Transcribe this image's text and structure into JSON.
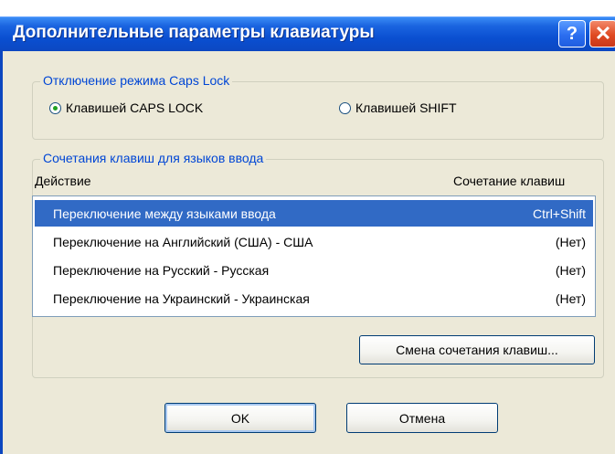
{
  "window": {
    "title": "Дополнительные параметры клавиатуры",
    "help_glyph": "?",
    "close_glyph": "✕"
  },
  "caps_group": {
    "legend": "Отключение режима Caps Lock",
    "option_caps": "Клавишей CAPS LOCK",
    "option_shift": "Клавишей SHIFT",
    "selected": "caps"
  },
  "hotkeys_group": {
    "legend": "Сочетания клавиш для языков ввода",
    "col_action": "Действие",
    "col_keys": "Сочетание клавиш",
    "rows": [
      {
        "action": "Переключение между языками ввода",
        "keys": "Ctrl+Shift",
        "selected": true
      },
      {
        "action": "Переключение на Английский (США) - США",
        "keys": "(Нет)"
      },
      {
        "action": "Переключение на Русский - Русская",
        "keys": "(Нет)"
      },
      {
        "action": "Переключение на Украинский - Украинская",
        "keys": "(Нет)"
      }
    ],
    "change_button": "Смена сочетания клавиш..."
  },
  "buttons": {
    "ok": "OK",
    "cancel": "Отмена"
  },
  "colors": {
    "title_bar": "#0c47c0",
    "selection": "#316ac5",
    "legend_text": "#0046d5",
    "dialog_bg": "#ece9d8"
  },
  "icons": {
    "help": "help-icon",
    "close": "close-icon"
  }
}
